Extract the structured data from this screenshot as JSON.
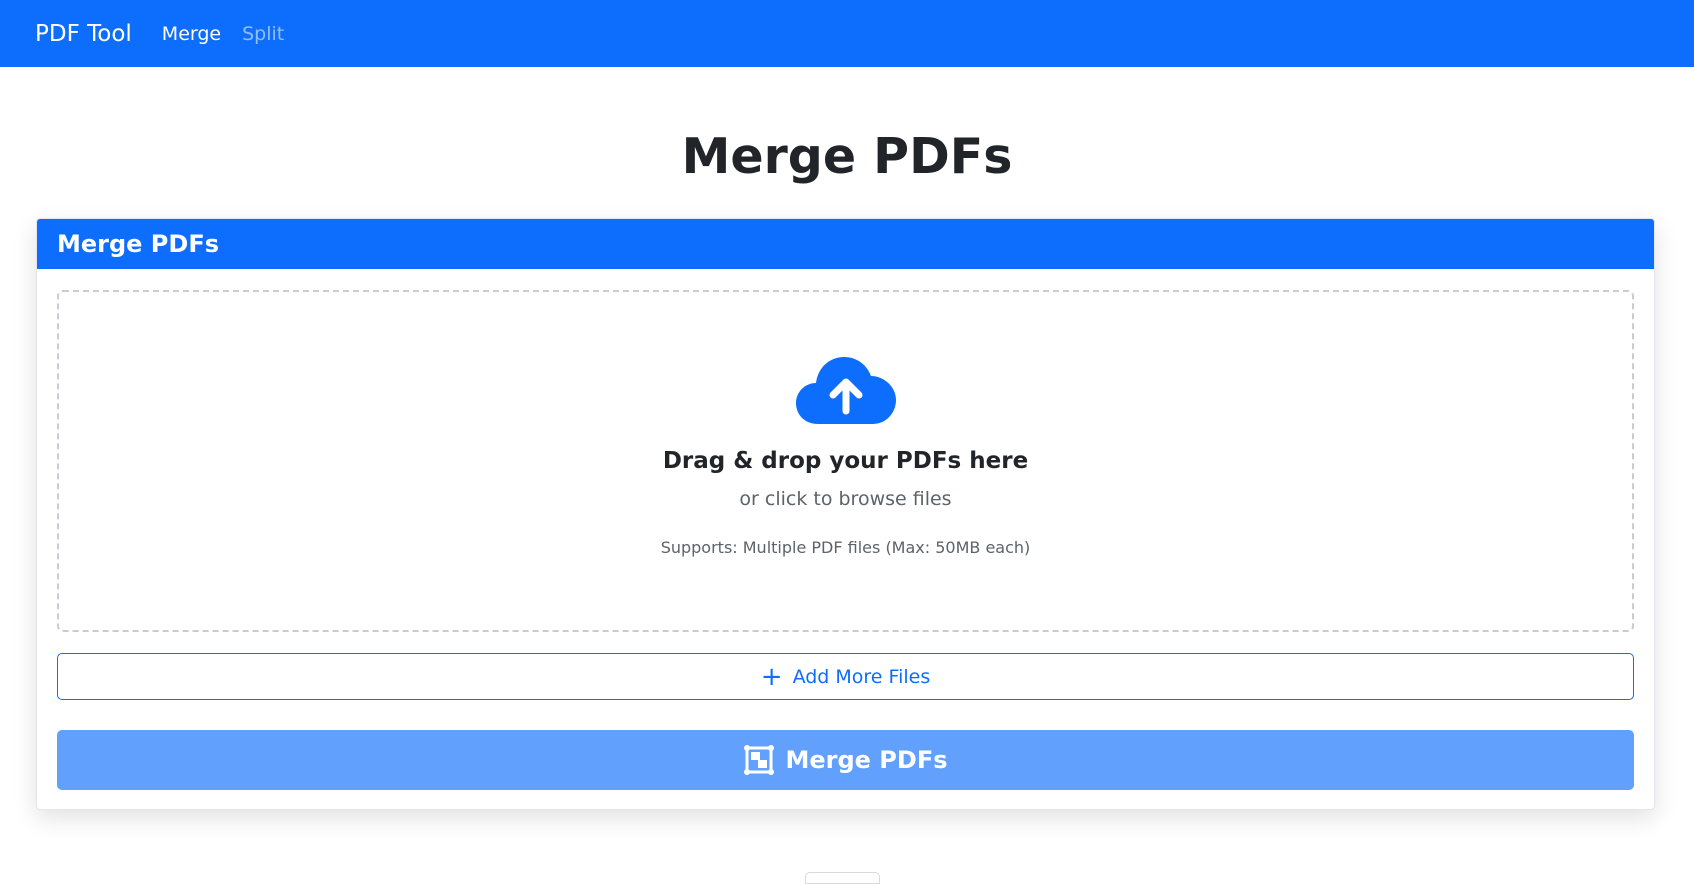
{
  "navbar": {
    "brand": "PDF Tool",
    "links": [
      {
        "label": "Merge",
        "active": true
      },
      {
        "label": "Split",
        "active": false
      }
    ]
  },
  "page": {
    "title": "Merge PDFs"
  },
  "card": {
    "header": "Merge PDFs",
    "dropzone": {
      "icon": "cloud-upload-icon",
      "title": "Drag & drop your PDFs here",
      "subtitle": "or click to browse files",
      "support": "Supports: Multiple PDF files (Max: 50MB each)"
    },
    "add_button": {
      "icon": "plus-icon",
      "label": "Add More Files"
    },
    "merge_button": {
      "icon": "merge-icon",
      "label": "Merge PDFs"
    }
  },
  "colors": {
    "primary": "#0d6efd",
    "primary_disabled": "#62a0fd",
    "dropzone_border": "#c9ccd8"
  }
}
